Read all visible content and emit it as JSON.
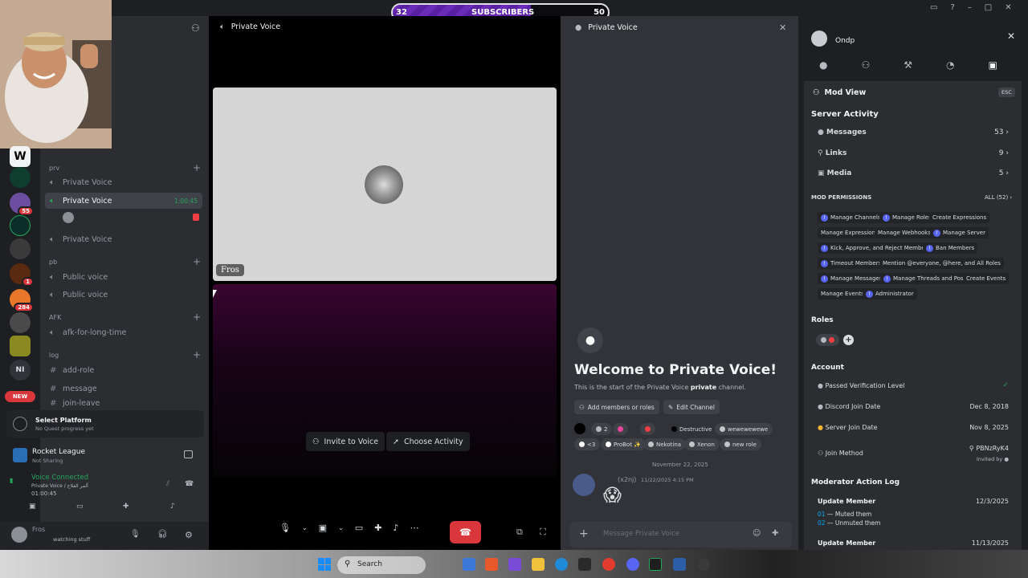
{
  "subscriber_bar": {
    "current": "32",
    "label": "SUBSCRIBERS",
    "goal": "50",
    "progress": 0.64
  },
  "sidebar": {
    "categories": [
      {
        "name": "prv",
        "channels": [
          "Private Voice",
          "Private Voice",
          "Private Voice"
        ]
      },
      {
        "name": "pb",
        "channels": [
          "Public voice",
          "Public voice"
        ]
      },
      {
        "name": "AFK",
        "channels": [
          "afk-for-long-time"
        ]
      },
      {
        "name": "log",
        "channels": [
          "add-role",
          "message",
          "join-leave"
        ]
      }
    ],
    "active_timer": "1:00:45",
    "rail_badges": [
      "55",
      "1",
      "284"
    ],
    "rail_text": [
      "NI",
      "NEW"
    ]
  },
  "quest": {
    "title": "Select Platform",
    "subtitle": "No Quest progress yet"
  },
  "activity": {
    "title": "Rocket League",
    "subtitle": "Not Sharing"
  },
  "voice_status": {
    "title": "Voice Connected",
    "channel": "Private Voice / ألمر الفلاح",
    "time": "01:00:45"
  },
  "user": {
    "name": "Fros",
    "status": "watching stuff"
  },
  "voice": {
    "header": "Private Voice",
    "tile_name": "Fros",
    "invite": "Invite to Voice",
    "activity": "Choose Activity"
  },
  "chat": {
    "header": "Private Voice",
    "welcome": "Welcome to Private Voice!",
    "intro_pre": "This is the start of the Private Voice",
    "intro_bold": "private",
    "intro_post": "channel.",
    "add_members": "Add members or roles",
    "edit_channel": "Edit Channel",
    "tags": [
      "2",
      "Destructive",
      "wewewewewe",
      "<3",
      "ProBot ✨",
      "Nekotina",
      "Xenon",
      "new role"
    ],
    "date": "November 22, 2025",
    "msg_user": "(x2nj)",
    "msg_time": "11/22/2025 4:15 PM",
    "input_placeholder": "Message Private Voice"
  },
  "mod": {
    "username": "Ondp",
    "title": "Mod View",
    "esc": "ESC",
    "server_activity": "Server Activity",
    "activity_rows": [
      {
        "label": "Messages",
        "value": "53"
      },
      {
        "label": "Links",
        "value": "9"
      },
      {
        "label": "Media",
        "value": "5"
      }
    ],
    "permissions_title": "MOD PERMISSIONS",
    "permissions_all": "ALL (52)",
    "permissions": [
      "Manage Channels",
      "Manage Roles",
      "Create Expressions",
      "Manage Expressions",
      "Manage Webhooks",
      "Manage Server",
      "Kick, Approve, and Reject Members",
      "Ban Members",
      "Timeout Members",
      "Mention @everyone, @here, and All Roles",
      "Manage Messages",
      "Manage Threads and Posts",
      "Create Events",
      "Manage Events",
      "Administrator"
    ],
    "roles_title": "Roles",
    "account_title": "Account",
    "account_rows": [
      {
        "label": "Passed Verification Level",
        "value": "✓"
      },
      {
        "label": "Discord Join Date",
        "value": "Dec 8, 2018"
      },
      {
        "label": "Server Join Date",
        "value": "Nov 8, 2025"
      },
      {
        "label": "Join Method",
        "value": "PBNzRyK4"
      }
    ],
    "invited_by": "Invited by",
    "log_title": "Moderator Action Log",
    "log": [
      {
        "action": "Update Member",
        "date": "12/3/2025",
        "details": [
          "Muted them",
          "Unmuted them"
        ]
      },
      {
        "action": "Update Member",
        "date": "11/13/2025",
        "details": []
      }
    ]
  },
  "taskbar": {
    "search": "Search"
  }
}
